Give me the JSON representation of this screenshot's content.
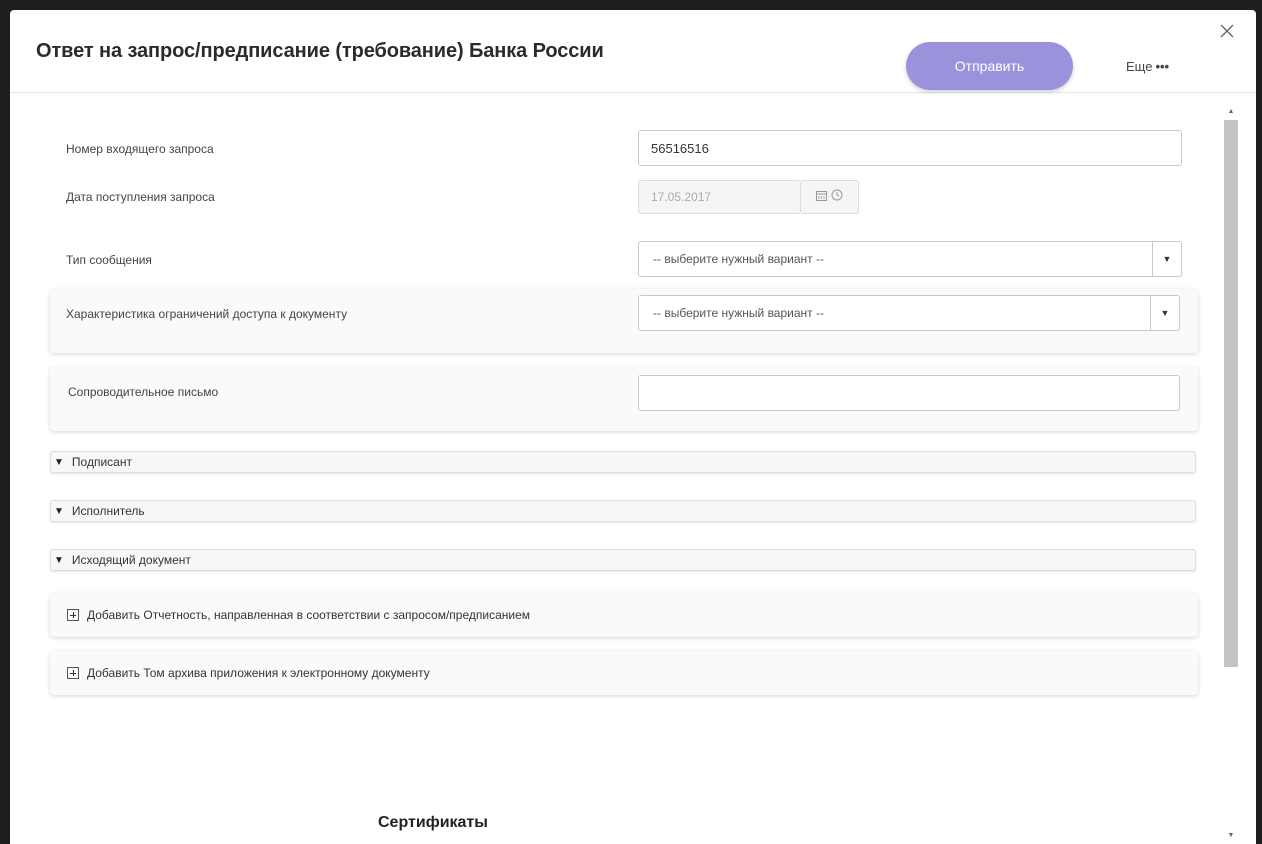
{
  "dialog": {
    "title": "Ответ на запрос/предписание (требование) Банка России",
    "send_label": "Отправить",
    "more_label": "Еще",
    "more_dots": "•••"
  },
  "fields": {
    "request_number": {
      "label": "Номер входящего запроса",
      "value": "56516516"
    },
    "request_date": {
      "label": "Дата поступления запроса",
      "value": "17.05.2017"
    },
    "message_type": {
      "label": "Тип сообщения",
      "value": "-- выберите нужный вариант --"
    },
    "access_restriction": {
      "label": "Характеристика ограничений доступа к документу",
      "value": "-- выберите нужный вариант --"
    },
    "cover_letter": {
      "label": "Сопроводительное письмо",
      "value": ""
    }
  },
  "sections": [
    {
      "label": "Подписант"
    },
    {
      "label": "Исполнитель"
    },
    {
      "label": "Исходящий документ"
    }
  ],
  "add_items": [
    {
      "label": "Добавить Отчетность, направленная в соответствии с запросом/предписанием"
    },
    {
      "label": "Добавить Том архива приложения к электронному документу"
    }
  ],
  "certificates_title": "Сертификаты",
  "colors": {
    "accent": "#9a93dc",
    "background": "#ffffff"
  },
  "icons": [
    "close-icon",
    "calendar-icon",
    "clock-icon",
    "dropdown-arrow-icon",
    "triangle-down-icon",
    "plus-box-icon"
  ]
}
